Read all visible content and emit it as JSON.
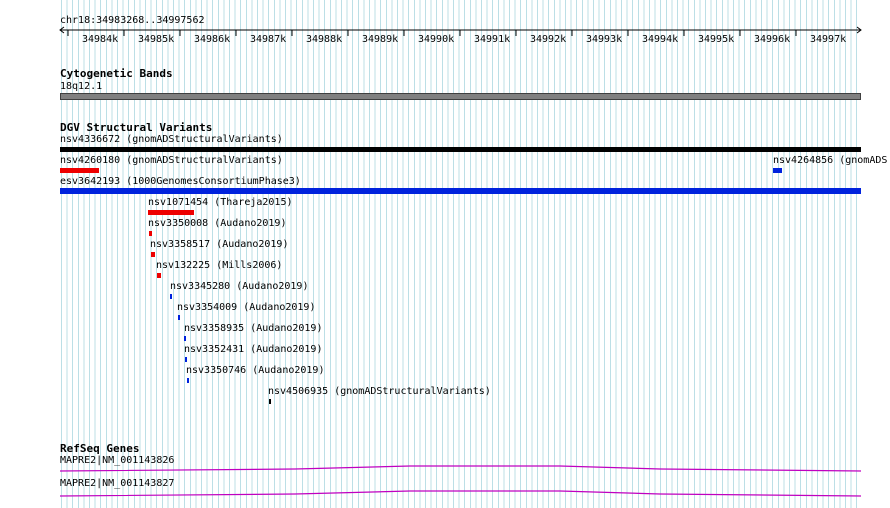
{
  "location": "chr18:34983268..34997562",
  "ruler": {
    "ticks": [
      "34984k",
      "34985k",
      "34986k",
      "34987k",
      "34988k",
      "34989k",
      "34990k",
      "34991k",
      "34992k",
      "34993k",
      "34994k",
      "34995k",
      "34996k",
      "34997k"
    ]
  },
  "tracks": {
    "cytoband": {
      "title": "Cytogenetic Bands",
      "band_label": "18q12.1",
      "band_color": "#808080"
    },
    "dgv": {
      "title": "DGV Structural Variants",
      "features": [
        {
          "label": "nsv4336672 (gnomADStructuralVariants)",
          "color": "#000000"
        },
        {
          "label": "nsv4260180 (gnomADStructuralVariants)",
          "color": "#ee0000"
        },
        {
          "label": "nsv4264856 (gnomADS",
          "color": "#0022dd"
        },
        {
          "label": "esv3642193 (1000GenomesConsortiumPhase3)",
          "color": "#0022dd"
        },
        {
          "label": "nsv1071454 (Thareja2015)",
          "color": "#ee0000"
        },
        {
          "label": "nsv3350008 (Audano2019)",
          "color": "#ee0000"
        },
        {
          "label": "nsv3358517 (Audano2019)",
          "color": "#ee0000"
        },
        {
          "label": "nsv132225 (Mills2006)",
          "color": "#ee0000"
        },
        {
          "label": "nsv3345280 (Audano2019)",
          "color": "#0022dd"
        },
        {
          "label": "nsv3354009 (Audano2019)",
          "color": "#0022dd"
        },
        {
          "label": "nsv3358935 (Audano2019)",
          "color": "#0022dd"
        },
        {
          "label": "nsv3352431 (Audano2019)",
          "color": "#0022dd"
        },
        {
          "label": "nsv3350746 (Audano2019)",
          "color": "#0022dd"
        },
        {
          "label": "nsv4506935 (gnomADStructuralVariants)",
          "color": "#000000"
        }
      ]
    },
    "refseq": {
      "title": "RefSeq Genes",
      "transcripts": [
        {
          "label": "MAPRE2|NM_001143826",
          "color": "#c000c0"
        },
        {
          "label": "MAPRE2|NM_001143827",
          "color": "#c000c0"
        }
      ]
    }
  }
}
